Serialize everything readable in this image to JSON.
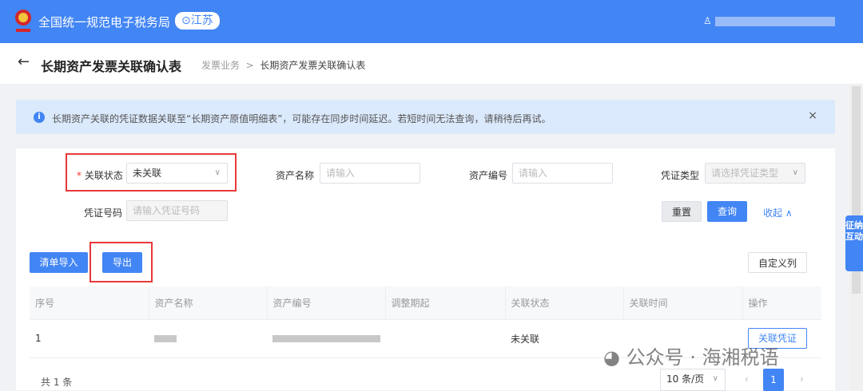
{
  "header": {
    "brand": "全国统一规范电子税务局",
    "region": "江苏",
    "user_icon": "user-icon"
  },
  "titlebar": {
    "title": "长期资产发票关联确认表",
    "breadcrumb": [
      "发票业务",
      "长期资产发票关联确认表"
    ],
    "separator": ">"
  },
  "banner": {
    "text": "长期资产关联的凭证数据关联至“长期资产原值明细表”，可能存在同步时间延迟。若短时间无法查询，请稍待后再试。",
    "close": "×"
  },
  "filters": {
    "status": {
      "label": "关联状态",
      "value": "未关联"
    },
    "asset_name": {
      "label": "资产名称",
      "placeholder": "请输入"
    },
    "asset_no": {
      "label": "资产编号",
      "placeholder": "请输入"
    },
    "voucher_type": {
      "label": "凭证类型",
      "placeholder": "请选择凭证类型"
    },
    "voucher_no": {
      "label": "凭证号码",
      "placeholder": "请输入凭证号码"
    },
    "reset": "重置",
    "query": "查询",
    "collapse": "收起"
  },
  "toolbar": {
    "import": "清单导入",
    "export": "导出",
    "custom_columns": "自定义列"
  },
  "table": {
    "columns": [
      "序号",
      "资产名称",
      "资产编号",
      "调整期起",
      "关联状态",
      "关联时间",
      "操作"
    ],
    "rows": [
      {
        "index": "1",
        "status": "未关联",
        "action": "关联凭证"
      }
    ]
  },
  "pagination": {
    "total": "共 1 条",
    "page_size": "10 条/页",
    "current": "1",
    "prev": "‹",
    "next": "›"
  },
  "side_tab": "征纳互动",
  "watermark": "公众号 · 海湘税语",
  "colors": {
    "primary": "#4285f4",
    "highlight": "#e8393a"
  }
}
